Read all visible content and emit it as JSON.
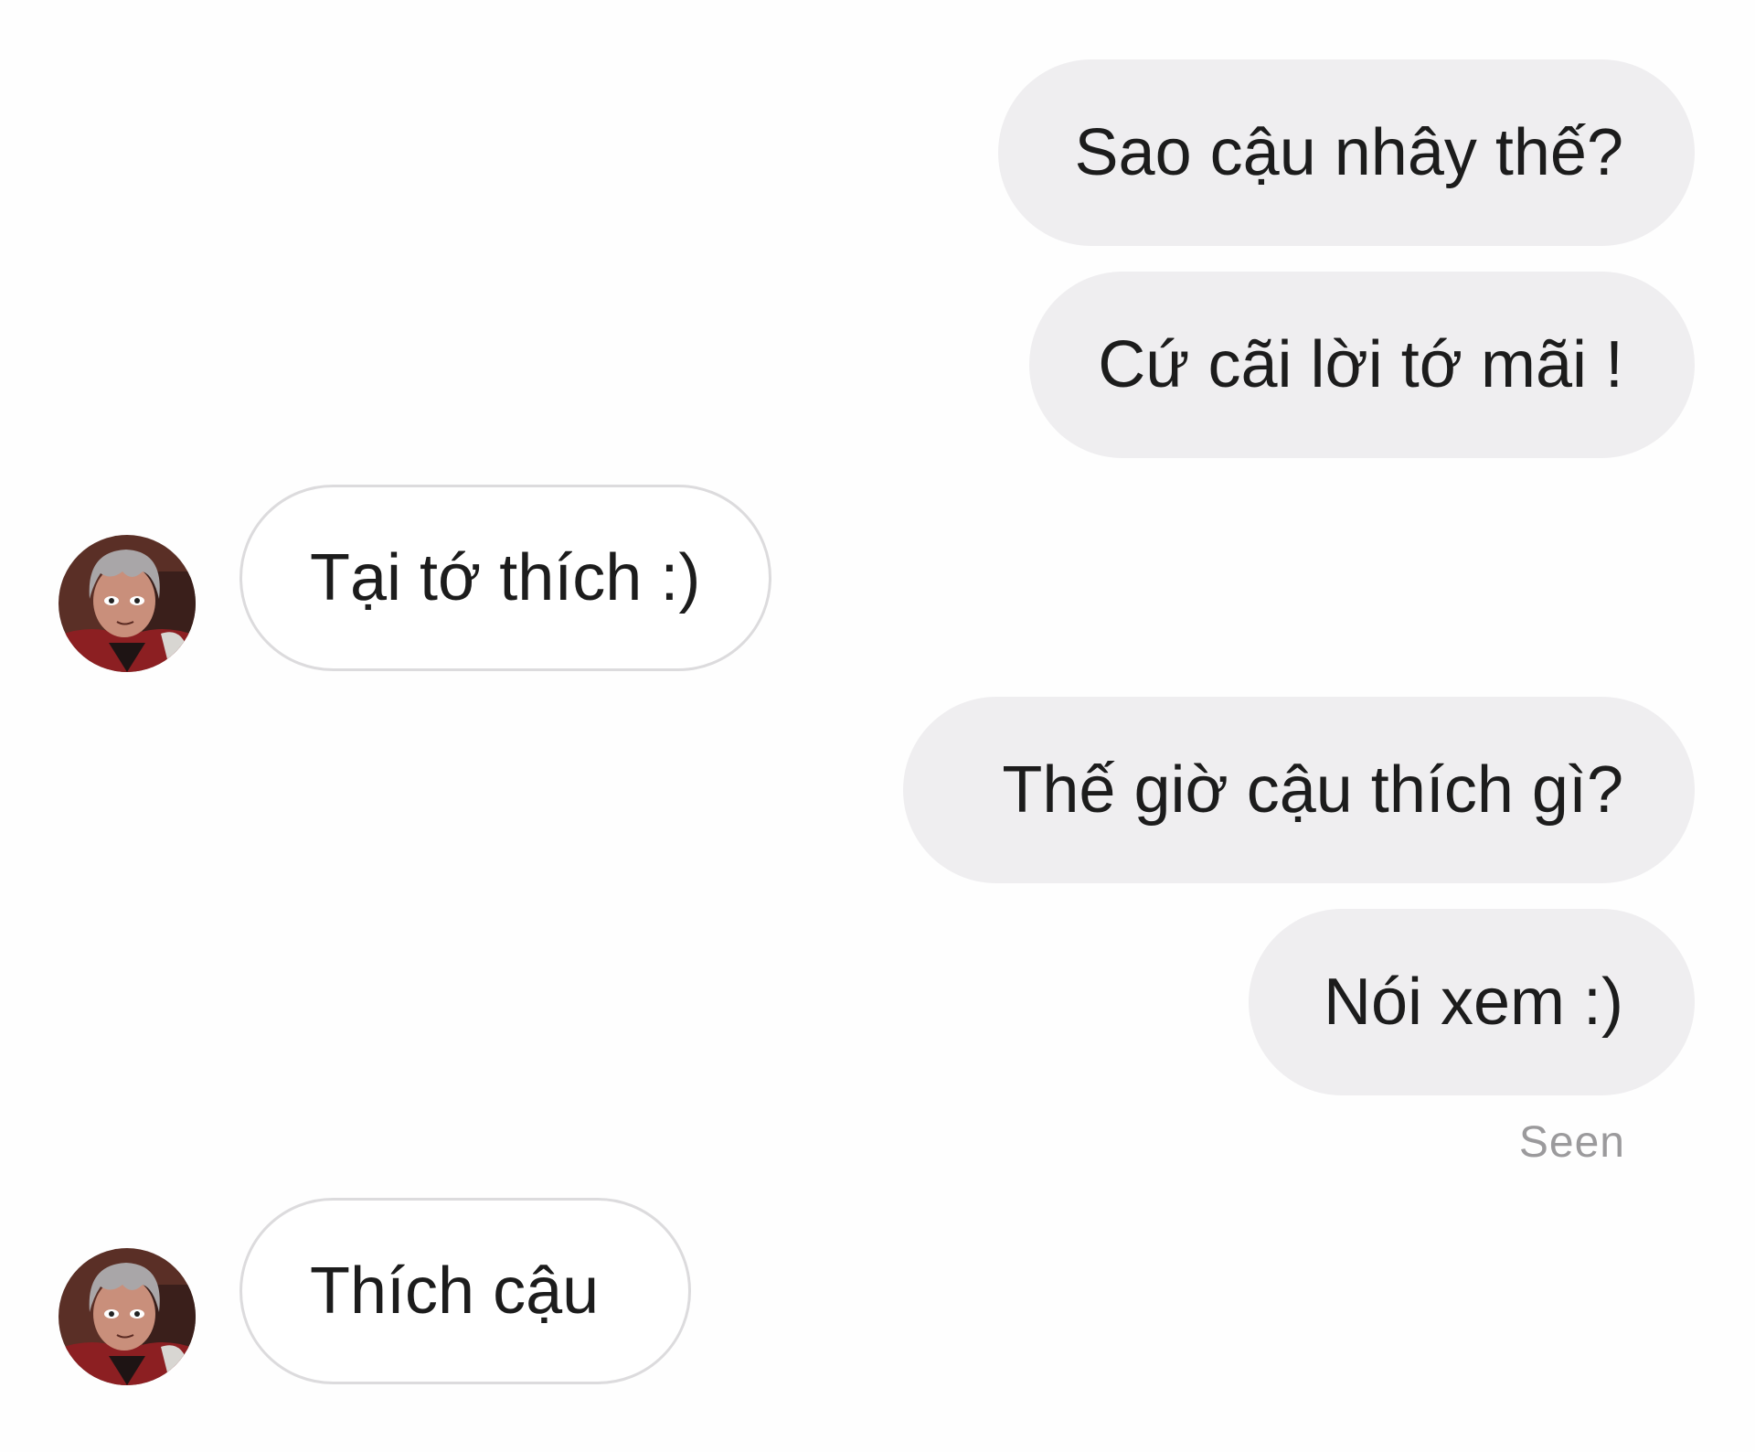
{
  "messages": [
    {
      "side": "sent",
      "text": "Sao cậu nhây thế?"
    },
    {
      "side": "sent",
      "text": "Cứ cãi lời tớ mãi !"
    },
    {
      "side": "received",
      "text": "Tại tớ thích :)"
    },
    {
      "side": "sent",
      "text": "Thế giờ cậu thích gì?"
    },
    {
      "side": "sent",
      "text": "Nói xem :)"
    },
    {
      "side": "received",
      "text": "Thích cậu"
    }
  ],
  "status": {
    "seen_label": "Seen"
  },
  "avatar": {
    "icon": "contact-avatar-icon"
  },
  "colors": {
    "sent_bubble": "#efeef0",
    "received_bubble_border": "#dcdbdd",
    "text": "#1c1c1c",
    "seen_text": "#9b9a9c"
  }
}
